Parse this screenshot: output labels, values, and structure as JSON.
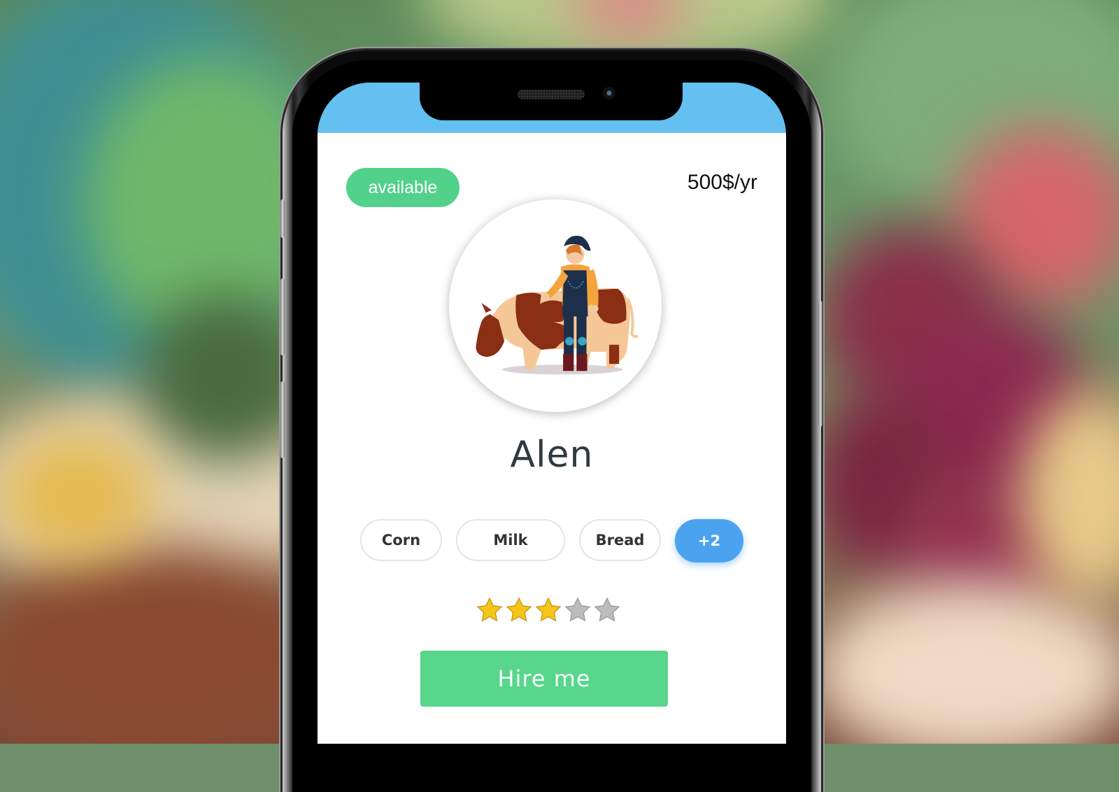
{
  "profile": {
    "availability": "available",
    "price": "500$/yr",
    "name": "Alen",
    "avatar_icon": "farmer-with-cow-illustration",
    "tags": [
      "Corn",
      "Milk",
      "Bread"
    ],
    "more_tags": "+2",
    "rating": {
      "value": 3,
      "max": 5
    },
    "hire_label": "Hire me"
  },
  "colors": {
    "status_bar": "#63c0f0",
    "available_badge": "#52d18b",
    "more_tag": "#4ba3f0",
    "hire_button": "#57d68c",
    "star_filled": "#f5c518",
    "star_empty": "#bdbdbd",
    "name_text": "#2f3a3f"
  }
}
